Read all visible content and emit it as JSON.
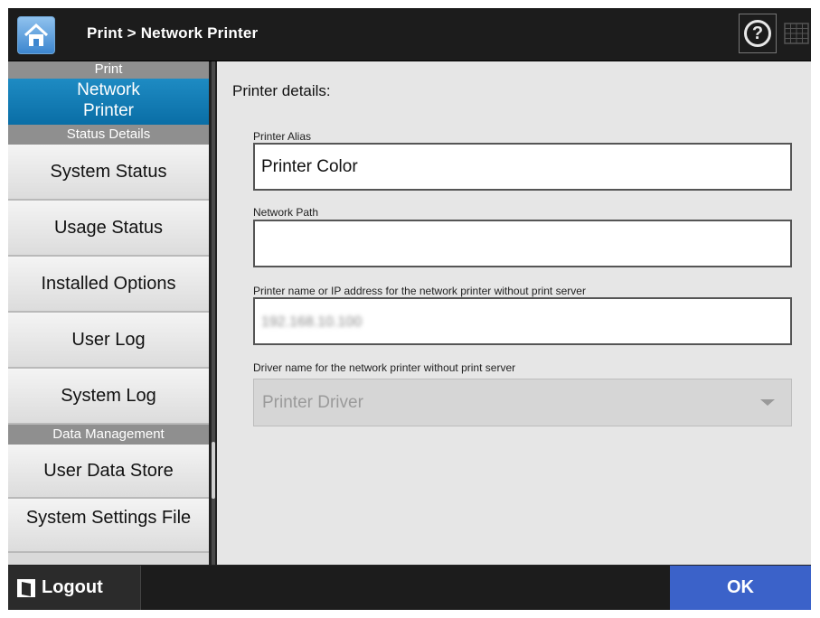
{
  "header": {
    "title": "Print > Network Printer",
    "help_icon_glyph": "?",
    "icons": [
      "home-icon",
      "help-icon",
      "keyboard-icon"
    ]
  },
  "sidebar": {
    "sections": [
      {
        "heading": "Print",
        "active_item": "Network\nPrinter"
      },
      {
        "heading": "Status Details",
        "items": [
          "System Status",
          "Usage Status",
          "Installed Options",
          "User Log",
          "System Log"
        ]
      },
      {
        "heading": "Data Management",
        "items": [
          "User Data Store",
          "System Settings File"
        ]
      }
    ]
  },
  "main": {
    "section_title": "Printer details:",
    "fields": [
      {
        "label": "Printer Alias",
        "value": "Printer Color"
      },
      {
        "label": "Network Path",
        "value": ""
      },
      {
        "label": "Printer name or IP address for the network printer without print server",
        "value": "192.168.10.100"
      },
      {
        "label": "Driver name for the network printer without print server",
        "value": "Printer Driver"
      }
    ]
  },
  "footer": {
    "logout_label": "Logout",
    "ok_label": "OK"
  },
  "colors": {
    "active_nav": "#0a7ab5",
    "ok_button": "#3b62c9",
    "topbar": "#1c1c1c",
    "section_header": "#8f8f8f"
  }
}
